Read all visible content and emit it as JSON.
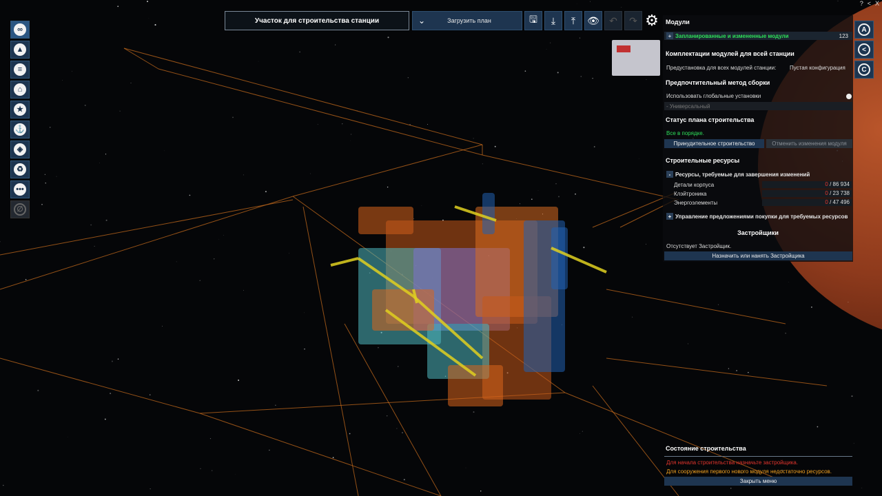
{
  "window_controls": [
    "?",
    "<",
    "X"
  ],
  "top_bar": {
    "plot_title": "Участок для строительства станции",
    "load_plan_label": "Загрузить план",
    "tools": [
      {
        "icon": "save-icon",
        "glyph": "🖫",
        "enabled": true
      },
      {
        "icon": "import-icon",
        "glyph": "⤓",
        "enabled": true
      },
      {
        "icon": "export-icon",
        "glyph": "⤒",
        "enabled": true
      },
      {
        "icon": "eye-icon",
        "glyph": "👁",
        "enabled": true
      },
      {
        "icon": "undo-icon",
        "glyph": "↶",
        "enabled": false
      },
      {
        "icon": "redo-icon",
        "glyph": "↷",
        "enabled": false
      }
    ],
    "settings_icon": "gear-icon"
  },
  "left_toolbar": [
    {
      "icon": "station-overview-icon",
      "glyph": "∞",
      "active": true
    },
    {
      "icon": "map-icon",
      "glyph": "▲",
      "active": false
    },
    {
      "icon": "list-icon",
      "glyph": "≡",
      "active": false
    },
    {
      "icon": "home-icon",
      "glyph": "⌂",
      "active": false
    },
    {
      "icon": "star-icon",
      "glyph": "★",
      "active": false
    },
    {
      "icon": "anchor-icon",
      "glyph": "⚓",
      "active": false
    },
    {
      "icon": "shield-icon",
      "glyph": "◈",
      "active": false
    },
    {
      "icon": "recycle-icon",
      "glyph": "♻",
      "active": false
    },
    {
      "icon": "more-icon",
      "glyph": "•••",
      "active": false
    },
    {
      "icon": "disabled-icon",
      "glyph": "∅",
      "active": false,
      "disabled": true
    }
  ],
  "right_toolbar": [
    {
      "icon": "letter-a-icon",
      "glyph": "A"
    },
    {
      "icon": "share-icon",
      "glyph": "<"
    },
    {
      "icon": "letter-c-icon",
      "glyph": "C"
    }
  ],
  "panel": {
    "modules_header": "Модули",
    "planned_modules": {
      "label": "Запланированные и измененные модули",
      "count": "123"
    },
    "loadouts_header": "Комплектации модулей для всей станции",
    "preset_label": "Предустановка для всех модулей станции:",
    "preset_value": "Пустая конфигурация",
    "build_method_header": "Предпочтительный метод сборки",
    "use_global": "Использовать глобальные установки",
    "universal": "- Универсальный",
    "plan_status_header": "Статус плана строительства",
    "plan_ok": "Все в порядке.",
    "force_build": "Принудительное строительство",
    "revert_changes": "Отменить изменения модуля",
    "resources_header": "Строительные ресурсы",
    "resources_required": "Ресурсы, требуемые для завершения изменений",
    "resources": [
      {
        "name": "Детали корпуса",
        "current": "0",
        "total": "/ 86 934"
      },
      {
        "name": "Клэйтроника",
        "current": "0",
        "total": "/ 23 738"
      },
      {
        "name": "Энергоэлементы",
        "current": "0",
        "total": "/ 47 496"
      }
    ],
    "buy_offers": "Управление предложениями покупки для требуемых ресурсов",
    "builders_header": "Застройщики",
    "no_builder": "Отсутствует Застройщик.",
    "assign_builder": "Назначить или нанять Застройщика"
  },
  "status": {
    "header": "Состояние строительства",
    "warn_builder": "Для начала строительства назначьте застройщика.",
    "warn_resources": "Для сооружения первого нового модуля недостаточно ресурсов.",
    "close_menu": "Закрыть меню"
  },
  "colors": {
    "accent_blue": "#1e3550",
    "ok_green": "#2ee05a",
    "error_red": "#e3352d",
    "warning_orange": "#f0a020",
    "wireframe_orange": "#c46a1c"
  }
}
